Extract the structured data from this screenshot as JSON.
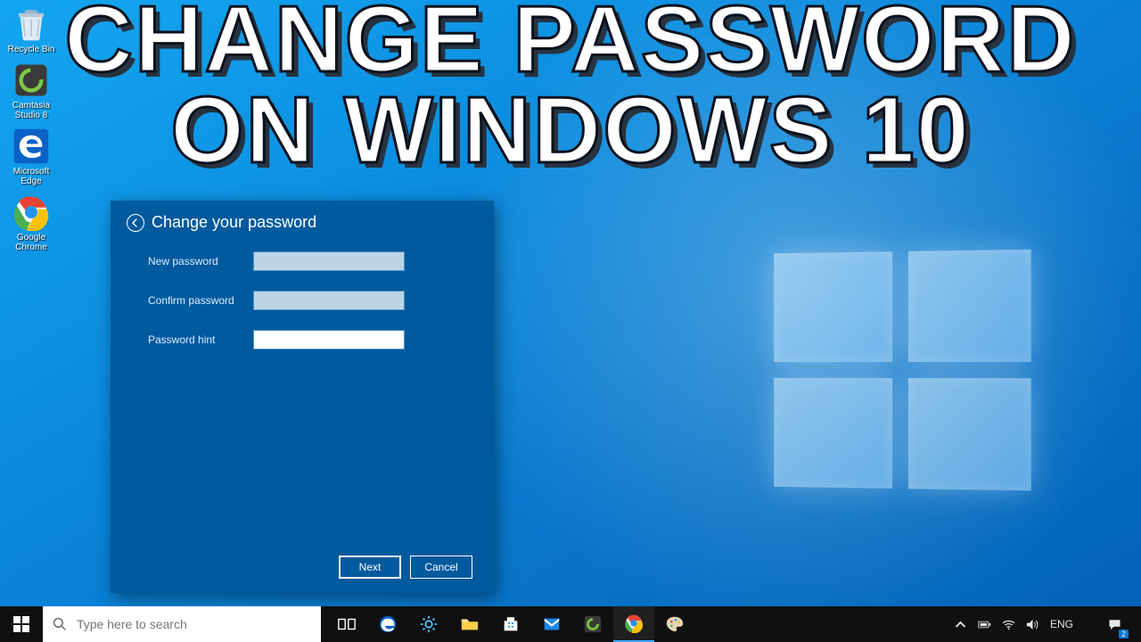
{
  "overlay": {
    "line1": "CHANGE PASSWORD",
    "line2": "ON WINDOWS 10"
  },
  "desktop": {
    "icons": [
      {
        "label": "Recycle Bin"
      },
      {
        "label": "Camtasia Studio 8"
      },
      {
        "label": "Microsoft Edge"
      },
      {
        "label": "Google Chrome"
      }
    ]
  },
  "dialog": {
    "title": "Change your password",
    "fields": {
      "new": {
        "label": "New password",
        "value": ""
      },
      "confirm": {
        "label": "Confirm password",
        "value": ""
      },
      "hint": {
        "label": "Password hint",
        "value": ""
      }
    },
    "buttons": {
      "next": "Next",
      "cancel": "Cancel"
    }
  },
  "taskbar": {
    "search_placeholder": "Type here to search",
    "tray": {
      "lang": "ENG",
      "time": "",
      "date": "",
      "notif_count": "2"
    }
  }
}
